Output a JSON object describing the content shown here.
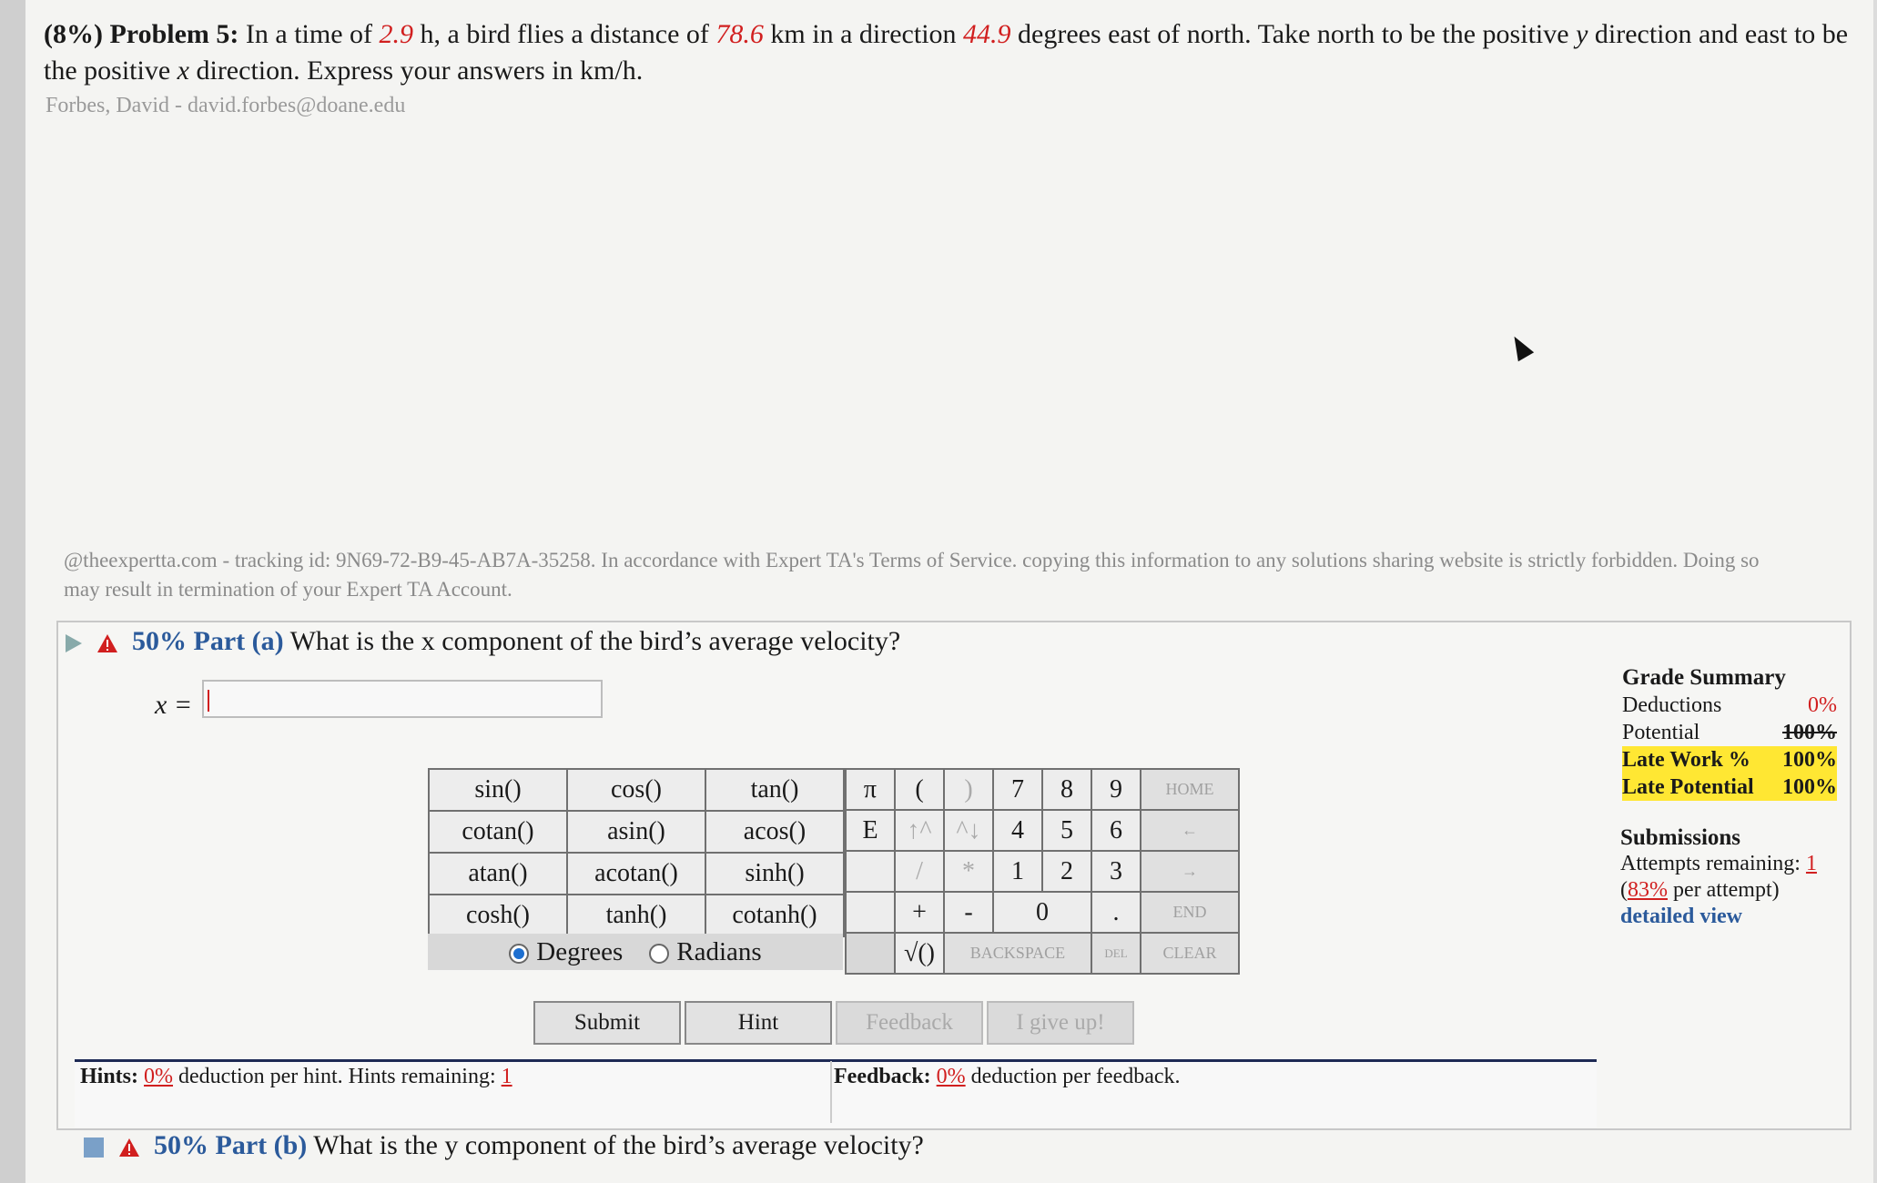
{
  "problem": {
    "pct": "(8%)",
    "title": "Problem 5:",
    "t1": "In a time of",
    "time": "2.9",
    "t2": "h, a bird flies a distance of",
    "dist": "78.6",
    "t3": "km in a direction",
    "angle": "44.9",
    "t4": "degrees east of north. Take north to be the positive",
    "y": "y",
    "t5": "direction and east to be the positive",
    "x": "x",
    "t6": "direction. Express your answers in km/h."
  },
  "author": "Forbes, David - david.forbes@doane.edu",
  "tracking": "@theexpertta.com - tracking id: 9N69-72-B9-45-AB7A-35258. In accordance with Expert TA's Terms of Service. copying this information to any solutions sharing website is strictly forbidden. Doing so may result in termination of your Expert TA Account.",
  "part_a": {
    "label": "50% Part (a)",
    "question": "What is the x component of the bird’s average velocity?",
    "var_label": "x =",
    "value": ""
  },
  "functions": [
    [
      "sin()",
      "cos()",
      "tan()"
    ],
    [
      "cotan()",
      "asin()",
      "acos()"
    ],
    [
      "atan()",
      "acotan()",
      "sinh()"
    ],
    [
      "cosh()",
      "tanh()",
      "cotanh()"
    ]
  ],
  "angle_mode": {
    "degrees": "Degrees",
    "radians": "Radians",
    "selected": "Degrees"
  },
  "keypad": {
    "pi": "π",
    "lparen": "(",
    "rparen": ")",
    "e": "E",
    "up": "↑^",
    "down": "^↓",
    "div": "/",
    "mul": "*",
    "plus": "+",
    "minus": "-",
    "sqrt": "√()",
    "dot": ".",
    "n7": "7",
    "n8": "8",
    "n9": "9",
    "n4": "4",
    "n5": "5",
    "n6": "6",
    "n1": "1",
    "n2": "2",
    "n3": "3",
    "n0": "0",
    "home": "HOME",
    "left": "←",
    "right": "→",
    "end": "END",
    "backspace": "BACKSPACE",
    "del": "DEL",
    "clear": "CLEAR"
  },
  "buttons": {
    "submit": "Submit",
    "hint": "Hint",
    "feedback": "Feedback",
    "giveup": "I give up!"
  },
  "hints": {
    "label": "Hints:",
    "pct": "0%",
    "text": "deduction per hint. Hints remaining:",
    "remaining": "1"
  },
  "feedback": {
    "label": "Feedback:",
    "pct": "0%",
    "text": "deduction per feedback."
  },
  "part_b": {
    "label": "50% Part (b)",
    "question": "What is the y component of the bird’s average velocity?"
  },
  "grade": {
    "title": "Grade Summary",
    "deductions_label": "Deductions",
    "deductions": "0%",
    "potential_label": "Potential",
    "potential": "100%",
    "late_work_label": "Late Work %",
    "late_work": "100%",
    "late_potential_label": "Late Potential",
    "late_potential": "100%"
  },
  "submissions": {
    "title": "Submissions",
    "attempts_label": "Attempts remaining:",
    "attempts": "1",
    "per_attempt_pct": "83%",
    "per_attempt_text": "per attempt)",
    "detail": "detailed view"
  },
  "colors": {
    "highlight": "#ffe733",
    "accent_red": "#d11f1f",
    "link_blue": "#2b5a9b"
  }
}
